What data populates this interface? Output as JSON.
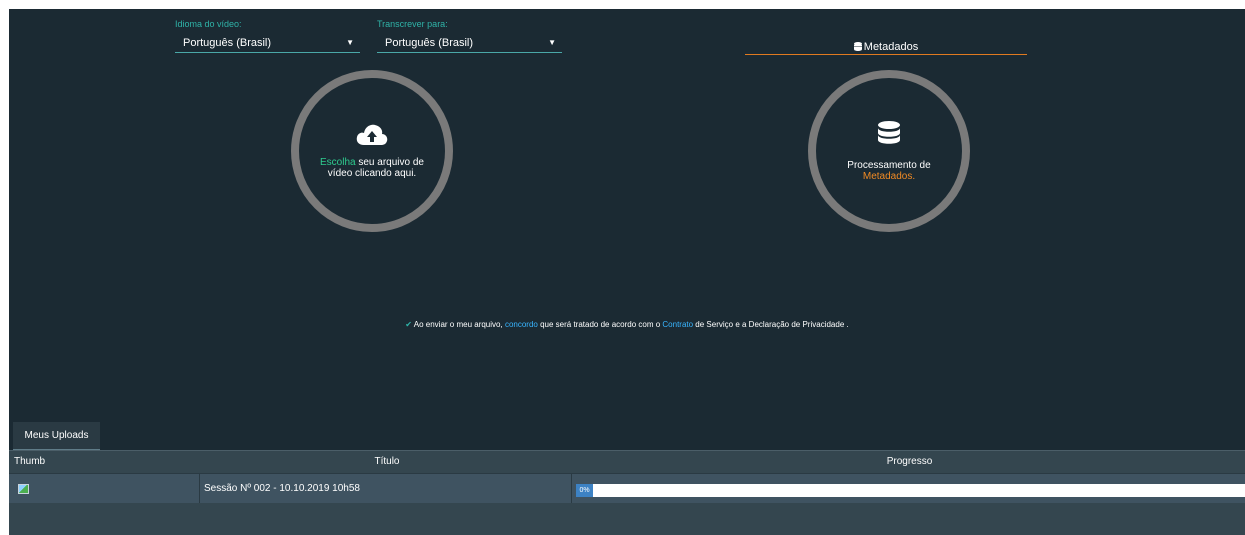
{
  "language": {
    "video_label": "Idioma do vídeo:",
    "video_value": "Português (Brasil)",
    "transcribe_label": "Transcrever para:",
    "transcribe_value": "Português (Brasil)"
  },
  "metadata_tab": {
    "label": "Metadados",
    "icon": "database-icon"
  },
  "upload": {
    "icon": "cloud-upload-icon",
    "highlight": "Escolha",
    "text": " seu arquivo de vídeo clicando aqui."
  },
  "processing": {
    "icon": "database-icon",
    "text": "Processamento de ",
    "highlight": "Metadados."
  },
  "consent": {
    "icon": "check-icon",
    "part1": " Ao enviar o meu arquivo, ",
    "link1": "concordo",
    "part2": " que será tratado de acordo com o ",
    "link2": "Contrato",
    "part3": " de Serviço e a Declaração de Privacidade ."
  },
  "uploads": {
    "tab_label": "Meus Uploads",
    "columns": [
      "Thumb",
      "Título",
      "Progresso"
    ],
    "rows": [
      {
        "thumb": "image-icon",
        "title": "Sessão Nº 002 - 10.10.2019 10h58",
        "progress_label": "0%",
        "progress": 0
      }
    ]
  },
  "colors": {
    "accent_teal": "#2ecc8f",
    "accent_orange": "#f08a24",
    "link_blue": "#38b5ff",
    "background": "#1b2a33"
  }
}
